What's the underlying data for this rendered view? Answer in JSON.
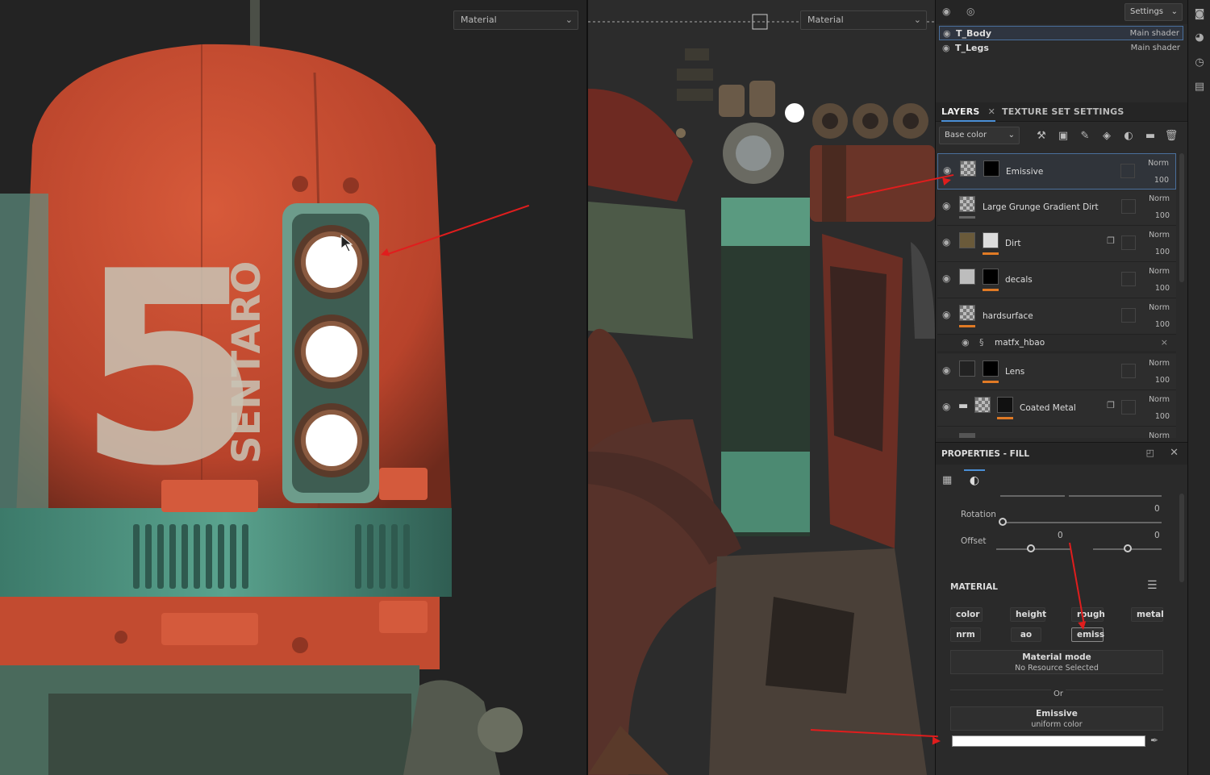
{
  "viewport3d": {
    "mode_select": "Material",
    "model_text": {
      "number": "5",
      "name": "SENTARO"
    }
  },
  "viewport2d": {
    "mode_select": "Material"
  },
  "texture_sets": {
    "settings_label": "Settings",
    "items": [
      {
        "name": "T_Body",
        "shader": "Main shader",
        "selected": true
      },
      {
        "name": "T_Legs",
        "shader": "Main shader",
        "selected": false
      }
    ]
  },
  "tabs": {
    "layers": "LAYERS",
    "texture_set_settings": "TEXTURE SET SETTINGS"
  },
  "toolbar": {
    "channel": "Base color"
  },
  "layers": [
    {
      "name": "Emissive",
      "blend": "Norm",
      "opacity": "100",
      "selected": true,
      "bar": "none"
    },
    {
      "name": "Large Grunge Gradient Dirt",
      "blend": "Norm",
      "opacity": "100",
      "selected": false,
      "bar": "gray"
    },
    {
      "name": "Dirt",
      "blend": "Norm",
      "opacity": "100",
      "selected": false,
      "bar": "orange"
    },
    {
      "name": "decals",
      "blend": "Norm",
      "opacity": "100",
      "selected": false,
      "bar": "orange"
    },
    {
      "name": "hardsurface",
      "blend": "Norm",
      "opacity": "100",
      "selected": false,
      "bar": "orange"
    },
    {
      "name": "matfx_hbao",
      "blend": "",
      "opacity": "",
      "selected": false,
      "bar": "none",
      "is_filter": true
    },
    {
      "name": "Lens",
      "blend": "Norm",
      "opacity": "100",
      "selected": false,
      "bar": "orange"
    },
    {
      "name": "Coated Metal",
      "blend": "Norm",
      "opacity": "100",
      "selected": false,
      "bar": "orange"
    },
    {
      "name": "",
      "blend": "Norm",
      "opacity": "",
      "selected": false,
      "bar": "none"
    }
  ],
  "properties": {
    "title": "PROPERTIES - FILL",
    "rotation_label": "Rotation",
    "rotation_value": "0",
    "offset_label": "Offset",
    "offset_x": "0",
    "offset_y": "0",
    "material_header": "MATERIAL",
    "channels": [
      {
        "label": "color",
        "on": false
      },
      {
        "label": "height",
        "on": false
      },
      {
        "label": "rough",
        "on": false
      },
      {
        "label": "metal",
        "on": false
      },
      {
        "label": "nrm",
        "on": false
      },
      {
        "label": "ao",
        "on": false
      },
      {
        "label": "emiss",
        "on": true
      }
    ],
    "material_mode_title": "Material mode",
    "material_mode_sub": "No Resource Selected",
    "or_label": "Or",
    "emissive_title": "Emissive",
    "emissive_sub": "uniform color",
    "emissive_color": "#ffffff"
  },
  "colors": {
    "accent_selection": "#4a6f9c",
    "annotation_arrow": "#e01d1d",
    "mask_bar": "#e07a25"
  }
}
